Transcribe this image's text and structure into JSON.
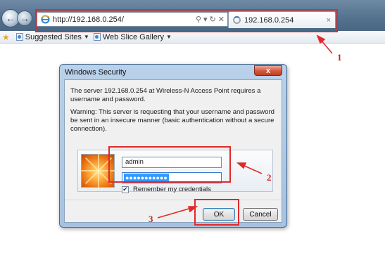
{
  "browser": {
    "address_url": "http://192.168.0.254/",
    "address_controls": {
      "search_glyph": "search-icon",
      "dropdown_glyph": "chevron-down-icon",
      "refresh_glyph": "refresh-icon",
      "stop_glyph": "close-icon"
    },
    "tab": {
      "title": "192.168.0.254",
      "close": "×"
    }
  },
  "favorites_bar": {
    "items": [
      {
        "label": "Suggested Sites",
        "icon": "page-icon"
      },
      {
        "label": "Web Slice Gallery",
        "icon": "page-icon"
      }
    ]
  },
  "dialog": {
    "title": "Windows Security",
    "close_label": "x",
    "message": "The server 192.168.0.254 at Wireless-N Access Point requires a username and password.",
    "warning": "Warning: This server is requesting that your username and password be sent in an insecure manner (basic authentication without a secure connection).",
    "username_value": "admin",
    "password_mask": "●●●●●●●●●●●",
    "remember_label": "Remember my credentials",
    "remember_checked": true,
    "ok_label": "OK",
    "cancel_label": "Cancel"
  },
  "annotations": {
    "label_1": "1",
    "label_2": "2",
    "label_3": "3",
    "color": "#e02a2a"
  }
}
